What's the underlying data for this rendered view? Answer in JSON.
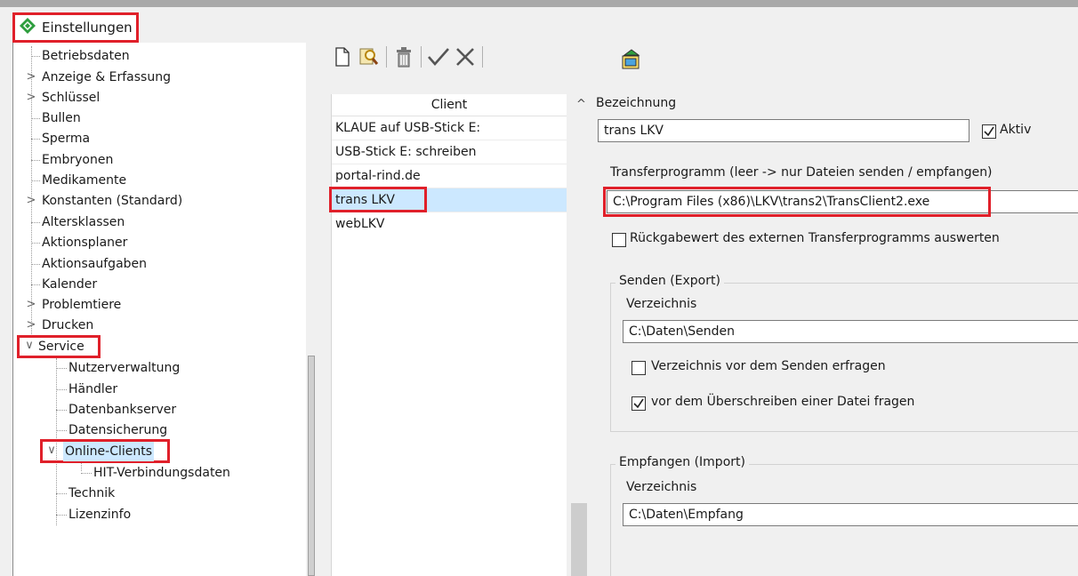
{
  "window": {
    "title": "Einstellungen"
  },
  "tree": {
    "items": [
      {
        "label": "Betriebsdaten"
      },
      {
        "label": "Anzeige & Erfassung"
      },
      {
        "label": "Schlüssel"
      },
      {
        "label": "Bullen"
      },
      {
        "label": "Sperma"
      },
      {
        "label": "Embryonen"
      },
      {
        "label": "Medikamente"
      },
      {
        "label": "Konstanten (Standard)"
      },
      {
        "label": "Altersklassen"
      },
      {
        "label": "Aktionsplaner"
      },
      {
        "label": "Aktionsaufgaben"
      },
      {
        "label": "Kalender"
      },
      {
        "label": "Problemtiere"
      },
      {
        "label": "Drucken"
      },
      {
        "label": "Service"
      },
      {
        "label": "Nutzerverwaltung"
      },
      {
        "label": "Händler"
      },
      {
        "label": "Datenbankserver"
      },
      {
        "label": "Datensicherung"
      },
      {
        "label": "Online-Clients"
      },
      {
        "label": "HIT-Verbindungsdaten"
      },
      {
        "label": "Technik"
      },
      {
        "label": "Lizenzinfo"
      }
    ]
  },
  "toolbar": {
    "icons": [
      "new-document-icon",
      "search-icon",
      "delete-icon",
      "check-icon",
      "close-icon",
      "transfer-icon"
    ]
  },
  "client_list": {
    "header": "Client",
    "rows": [
      {
        "label": "KLAUE auf USB-Stick E:"
      },
      {
        "label": "USB-Stick E: schreiben"
      },
      {
        "label": "portal-rind.de"
      },
      {
        "label": "trans LKV"
      },
      {
        "label": "webLKV"
      }
    ],
    "selected": "trans LKV"
  },
  "detail": {
    "collapse_glyph": "^",
    "bezeichnung_label": "Bezeichnung",
    "bezeichnung_value": "trans LKV",
    "aktiv_label": "Aktiv",
    "aktiv_checked": true,
    "transfer_label": "Transferprogramm (leer -> nur Dateien senden / empfangen)",
    "transfer_value": "C:\\Program Files (x86)\\LKV\\trans2\\TransClient2.exe",
    "rueckgabe_label": "Rückgabewert des externen Transferprogramms auswerten",
    "rueckgabe_checked": false,
    "senden": {
      "title": "Senden (Export)",
      "dir_label": "Verzeichnis",
      "dir_value": "C:\\Daten\\Senden",
      "ask_dir_label": "Verzeichnis vor dem Senden erfragen",
      "ask_dir_checked": false,
      "overwrite_label": "vor dem Überschreiben einer Datei fragen",
      "overwrite_checked": true
    },
    "empfangen": {
      "title": "Empfangen (Import)",
      "dir_label": "Verzeichnis",
      "dir_value": "C:\\Daten\\Empfang"
    }
  },
  "colors": {
    "highlight": "#e0202a",
    "selection": "#cce8ff",
    "app_icon": "#2e9e3e"
  }
}
